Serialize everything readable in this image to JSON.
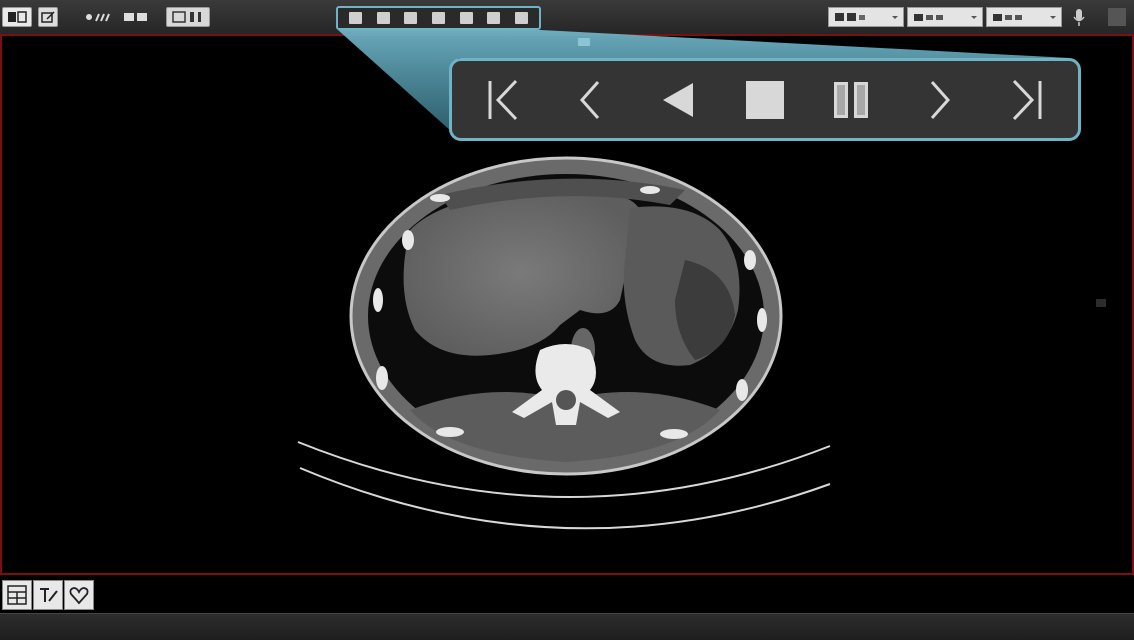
{
  "toolbar": {
    "left_tools": [
      {
        "icon": "viewer-mode-icon"
      },
      {
        "icon": "edit-icon"
      },
      {
        "icon": "measure-tools-icon"
      },
      {
        "icon": "annotation-tools-icon"
      },
      {
        "icon": "layout-icon"
      }
    ],
    "cine_strip_icon": "cine-controls-icon",
    "right_tools": [
      {
        "icon": "series-select-icon"
      },
      {
        "icon": "window-preset-icon"
      },
      {
        "icon": "tool-select-icon"
      }
    ],
    "settings_icon": "microphone-icon"
  },
  "cine_controls": [
    {
      "name": "first-frame-button",
      "icon": "first-frame-icon"
    },
    {
      "name": "previous-frame-button",
      "icon": "previous-frame-icon"
    },
    {
      "name": "play-reverse-button",
      "icon": "play-reverse-icon"
    },
    {
      "name": "stop-button",
      "icon": "stop-icon"
    },
    {
      "name": "pause-button",
      "icon": "pause-icon"
    },
    {
      "name": "next-frame-button",
      "icon": "next-frame-icon"
    },
    {
      "name": "last-frame-button",
      "icon": "last-frame-icon"
    }
  ],
  "colors": {
    "accent": "#6fb3c6",
    "frame_border": "#7a1010",
    "toolbar_bg": "#2c2c2c"
  },
  "bottom_tools": [
    {
      "icon": "grid-layout-icon"
    },
    {
      "icon": "annotate-icon"
    },
    {
      "icon": "heart-icon"
    }
  ]
}
